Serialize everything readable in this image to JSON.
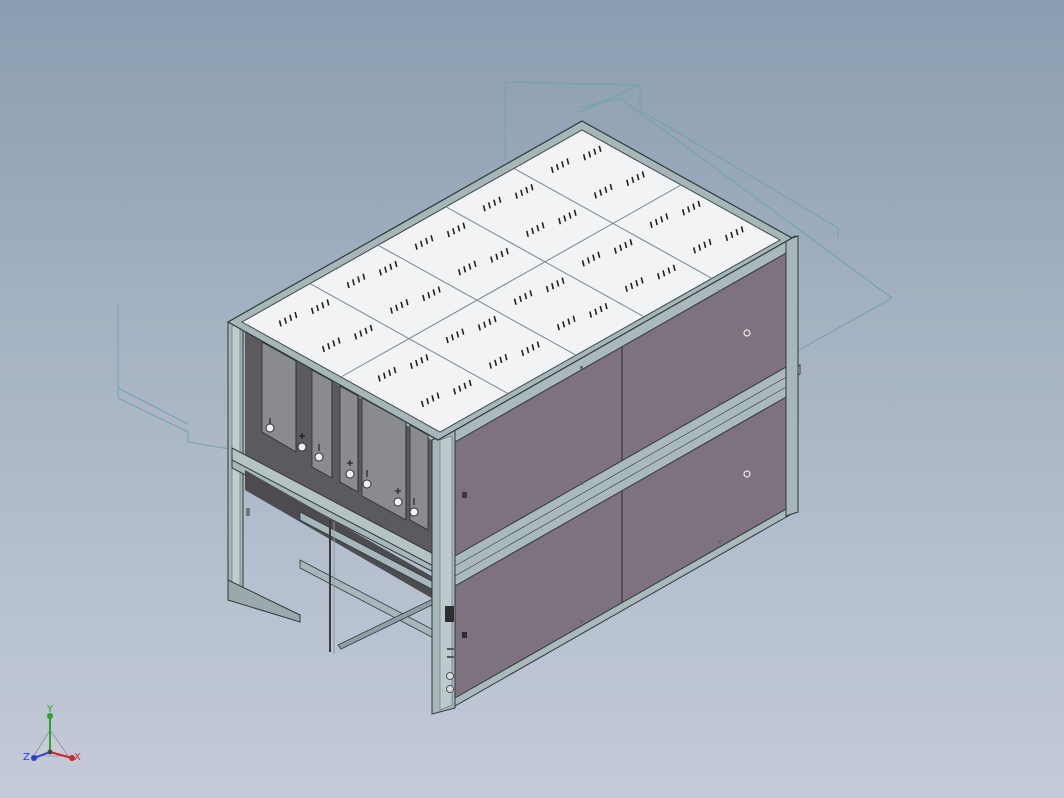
{
  "viewport": {
    "background_top": "#8a9db0",
    "background_bottom": "#c4cbd9"
  },
  "model": {
    "panel_color": "#7e727f",
    "frame_color": "#a7b7b9",
    "top_cover_color": "#f1f3f4",
    "sketch_line_color": "#6fa4a8",
    "top_cover_panels": 10,
    "slot_groups_per_panel": 4,
    "terminal_symbols": [
      "+",
      "-",
      "+",
      "-",
      "+",
      "-",
      "+",
      "-"
    ]
  },
  "triad": {
    "x_label": "X",
    "y_label": "Y",
    "z_label": "Z",
    "x_color": "#d8232a",
    "y_color": "#2aa52a",
    "z_color": "#2a3fcf"
  }
}
